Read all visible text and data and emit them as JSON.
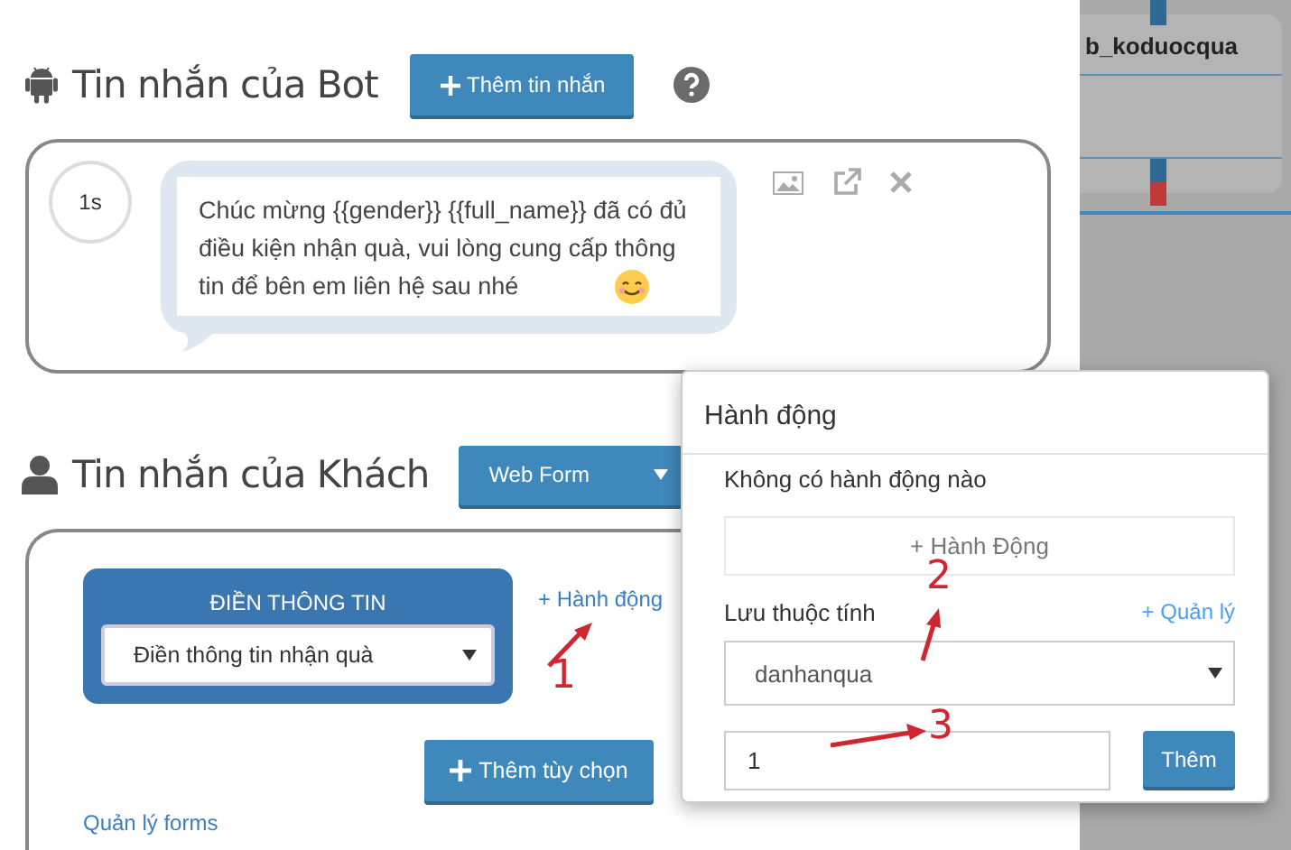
{
  "bot_section": {
    "title": "Tin nhắn của Bot",
    "add_button": "Thêm tin nhắn",
    "message": {
      "delay": "1s",
      "text": "Chúc mừng {{gender}} {{full_name}} đã có đủ điều kiện nhận quà, vui lòng cung cấp thông tin để bên em liên hệ sau nhé"
    }
  },
  "customer_section": {
    "title": "Tin nhắn của Khách",
    "type_dropdown": "Web Form",
    "form_card": {
      "heading": "ĐIỀN THÔNG TIN",
      "select_value": "Điền thông tin nhận quà"
    },
    "action_link": "+ Hành động",
    "add_option_button": "Thêm tùy chọn",
    "manage_link": "Quản lý forms"
  },
  "side_panel": {
    "label": "b_koduocqua"
  },
  "action_popover": {
    "title": "Hành động",
    "empty_text": "Không có hành động nào",
    "add_action_button": "+ Hành Động",
    "attribute_label": "Lưu thuộc tính",
    "manage_link": "+ Quản lý",
    "attribute_select": "danhanqua",
    "value_input": "1",
    "add_button": "Thêm"
  },
  "annotations": [
    {
      "label": "1"
    },
    {
      "label": "2"
    },
    {
      "label": "3"
    }
  ]
}
